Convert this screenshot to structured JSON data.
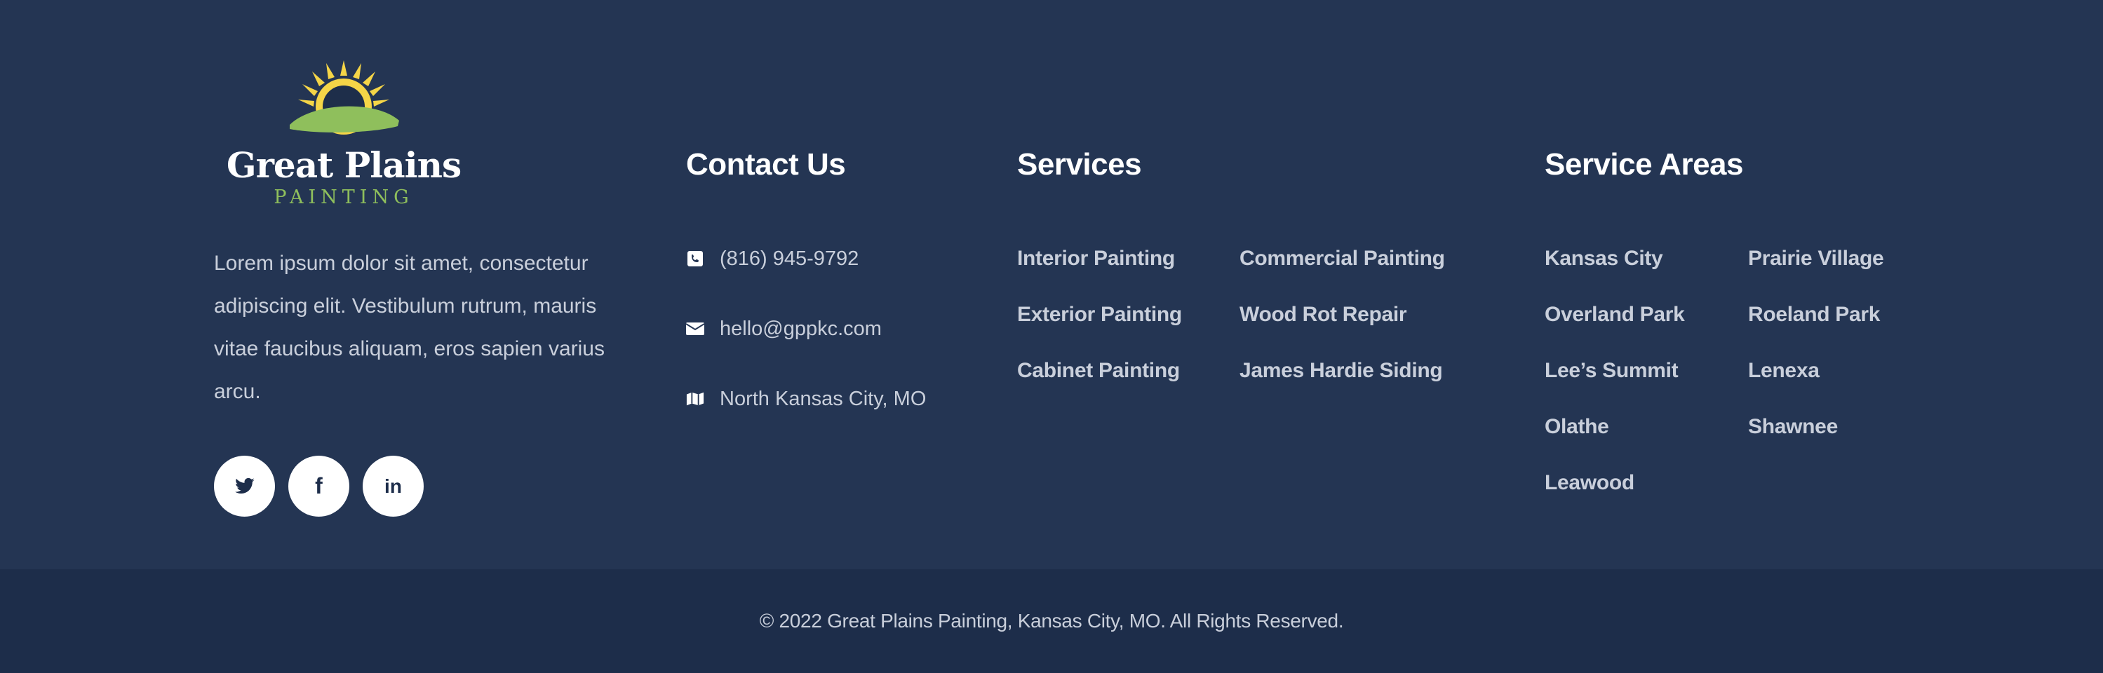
{
  "brand": {
    "name": "Great Plains",
    "subtitle": "PAINTING",
    "colors": {
      "sun": "#f5d547",
      "hill": "#8fbf5c",
      "background": "#243553",
      "bottom_bar": "#1d2d4a"
    }
  },
  "about": {
    "text": "Lorem ipsum dolor sit amet, consectetur adipiscing elit. Vestibulum rutrum, mauris vitae faucibus aliquam, eros sapien varius arcu."
  },
  "social": [
    {
      "icon": "twitter-icon",
      "glyph": "🐦"
    },
    {
      "icon": "facebook-icon",
      "glyph": "f"
    },
    {
      "icon": "linkedin-icon",
      "glyph": "in"
    }
  ],
  "contact": {
    "heading": "Contact Us",
    "phone": "(816) 945-9792",
    "email": "hello@gppkc.com",
    "location": "North Kansas City, MO"
  },
  "services": {
    "heading": "Services",
    "column1": [
      "Interior Painting",
      "Exterior Painting",
      "Cabinet Painting"
    ],
    "column2": [
      "Commercial Painting",
      "Wood Rot Repair",
      "James Hardie Siding"
    ]
  },
  "service_areas": {
    "heading": "Service Areas",
    "column1": [
      "Kansas City",
      "Overland Park",
      "Lee’s Summit",
      "Olathe",
      "Leawood"
    ],
    "column2": [
      "Prairie Village",
      "Roeland Park",
      "Lenexa",
      "Shawnee"
    ]
  },
  "footer": {
    "copyright": "© 2022 Great Plains Painting, Kansas City, MO. All Rights Reserved."
  }
}
